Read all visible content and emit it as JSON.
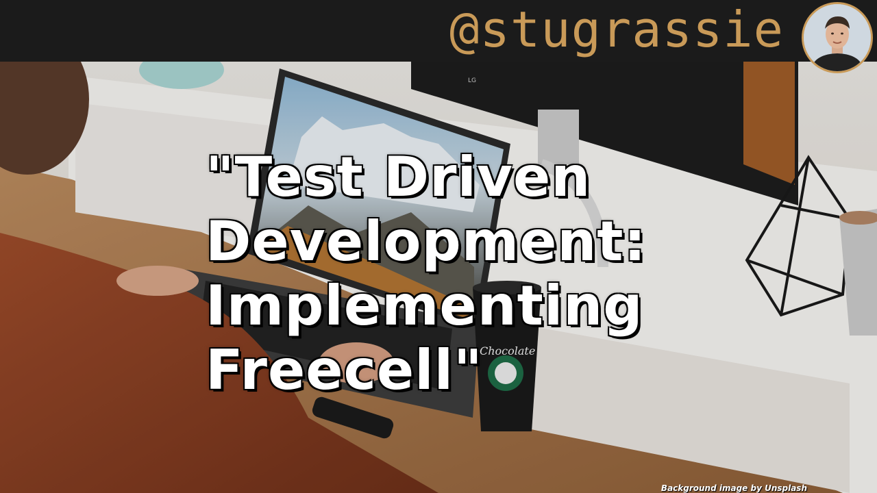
{
  "header": {
    "handle": "@stugrassie",
    "avatar_icon": "profile-photo-icon"
  },
  "slide": {
    "title_lines": [
      "\"Test Driven",
      "Development:",
      "Implementing",
      "Freecell\""
    ],
    "credit": "Background image by Unsplash"
  },
  "background": {
    "cup_text": "Chocolate",
    "monitor_brand": "LG"
  },
  "colors": {
    "bar": "#1b1b1b",
    "handle": "#c99a58",
    "title": "#ffffff"
  }
}
